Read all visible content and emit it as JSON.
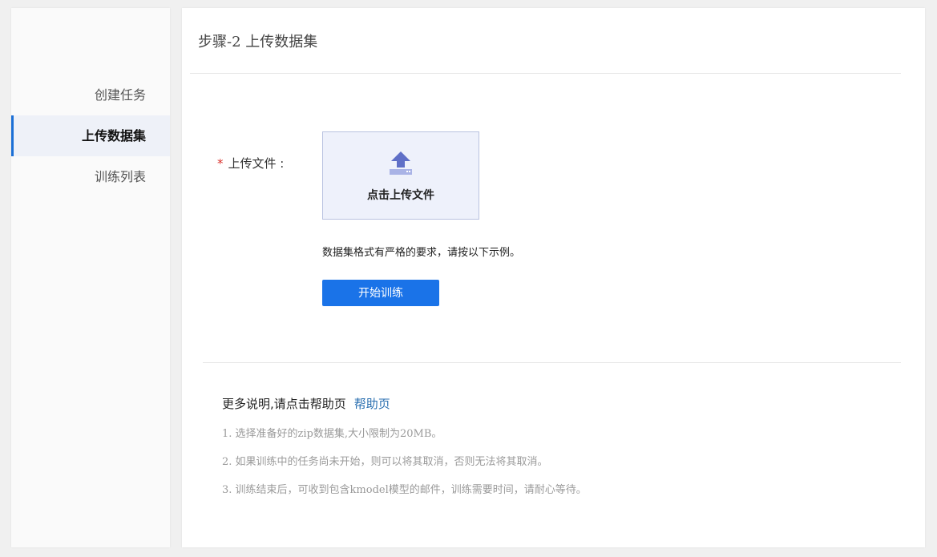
{
  "sidebar": {
    "items": [
      {
        "label": "创建任务"
      },
      {
        "label": "上传数据集"
      },
      {
        "label": "训练列表"
      }
    ]
  },
  "main": {
    "title": "步骤-2 上传数据集",
    "upload": {
      "required_mark": "*",
      "label": "上传文件 :",
      "button_text": "点击上传文件",
      "icon": "upload-icon"
    },
    "format_note": "数据集格式有严格的要求，请按以下示例。",
    "train_button": "开始训练",
    "help": {
      "text": "更多说明,请点击帮助页",
      "link": "帮助页"
    },
    "tips": [
      "1. 选择准备好的zip数据集,大小限制为20MB。",
      "2. 如果训练中的任务尚未开始，则可以将其取消，否则无法将其取消。",
      "3. 训练结束后，可收到包含kmodel模型的邮件，训练需要时间，请耐心等待。"
    ]
  },
  "colors": {
    "accent": "#1a73e8",
    "active_bar": "#1b6fd6",
    "required": "#d9302b",
    "link": "#2a6fb0"
  }
}
